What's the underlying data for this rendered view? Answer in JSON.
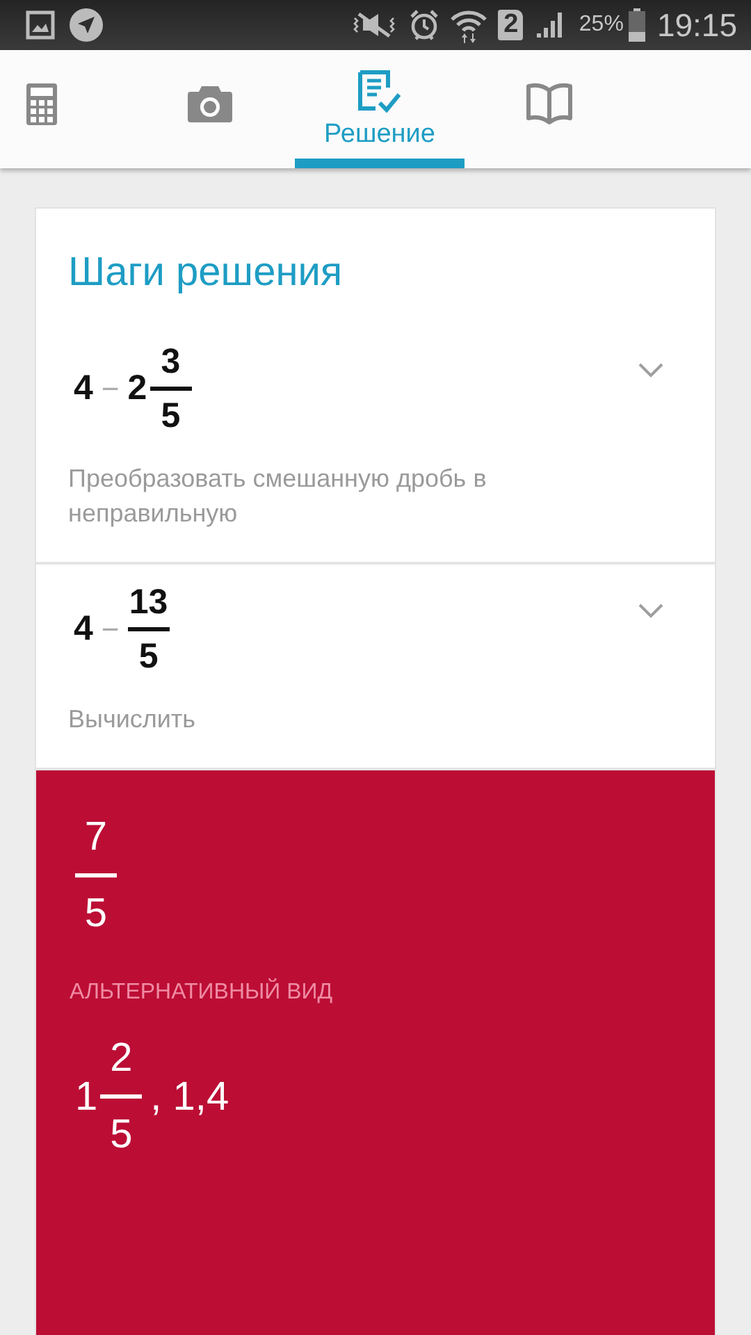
{
  "status_bar": {
    "sim_slot": "2",
    "battery": "25%",
    "time": "19:15"
  },
  "tabs": [
    {
      "kind": "calculator",
      "selected": false
    },
    {
      "kind": "camera",
      "selected": false
    },
    {
      "kind": "solution",
      "label": "Решение",
      "selected": true
    },
    {
      "kind": "book",
      "selected": false
    }
  ],
  "title": "Шаги решения",
  "steps": [
    {
      "expanded": false,
      "expression": [
        {
          "kind": "number",
          "text": "4"
        },
        {
          "kind": "op",
          "text": "−"
        },
        {
          "kind": "mixed",
          "whole": "2",
          "num": "3",
          "den": "5"
        }
      ],
      "description": "Преобразовать смешанную дробь в неправильную"
    },
    {
      "expanded": false,
      "expression": [
        {
          "kind": "number",
          "text": "4"
        },
        {
          "kind": "op",
          "text": "−"
        },
        {
          "kind": "frac",
          "num": "13",
          "den": "5"
        }
      ],
      "description": "Вычислить"
    }
  ],
  "result": {
    "expression": [
      {
        "kind": "frac",
        "num": "7",
        "den": "5"
      }
    ],
    "alt_label": "АЛЬТЕРНАТИВНЫЙ ВИД",
    "alt_expression": [
      {
        "kind": "mixed",
        "whole": "1",
        "num": "2",
        "den": "5"
      },
      {
        "kind": "number",
        "text": ", 1,4"
      }
    ]
  }
}
